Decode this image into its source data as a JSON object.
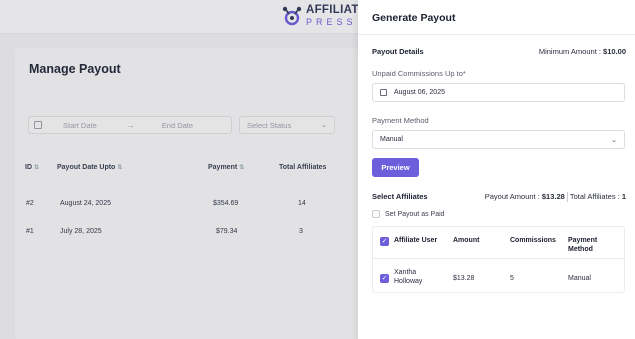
{
  "brand": {
    "line1": "AFFILIATE",
    "line2": "PRESS"
  },
  "page": {
    "title": "Manage Payout",
    "filters": {
      "start_date": "Start Date",
      "arrow": "→",
      "end_date": "End Date",
      "status": "Select Status"
    },
    "table": {
      "headers": {
        "id": "ID",
        "payout_date": "Payout Date Upto",
        "payment": "Payment",
        "total_affiliates": "Total Affiliates"
      },
      "rows": [
        {
          "id": "#2",
          "payout_date": "August 24, 2025",
          "payment": "$354.69",
          "total_affiliates": "14"
        },
        {
          "id": "#1",
          "payout_date": "July 28, 2025",
          "payment": "$79.34",
          "total_affiliates": "3"
        }
      ]
    }
  },
  "drawer": {
    "title": "Generate Payout",
    "payout_details": "Payout Details",
    "minimum_label": "Minimum Amount :",
    "minimum_value": "$10.00",
    "unpaid_label": "Unpaid Commissions Up to*",
    "unpaid_value": "August 06, 2025",
    "method_label": "Payment Method",
    "method_value": "Manual",
    "preview_button": "Preview",
    "select_affiliates": "Select Affiliates",
    "payout_amount_label": "Payout Amount :",
    "payout_amount_value": "$13.28",
    "total_affiliates_label": "Total Affiliates :",
    "total_affiliates_value": "1",
    "set_paid_label": "Set Payout as Paid",
    "table": {
      "headers": {
        "user": "Affiliate User",
        "amount": "Amount",
        "commissions": "Commissions",
        "method": "Payment Method"
      },
      "rows": [
        {
          "user": "Xantha Holloway",
          "amount": "$13.28",
          "commissions": "5",
          "method": "Manual"
        }
      ]
    }
  },
  "colors": {
    "accent": "#6d5fdc",
    "logo_dark": "#34395a"
  }
}
